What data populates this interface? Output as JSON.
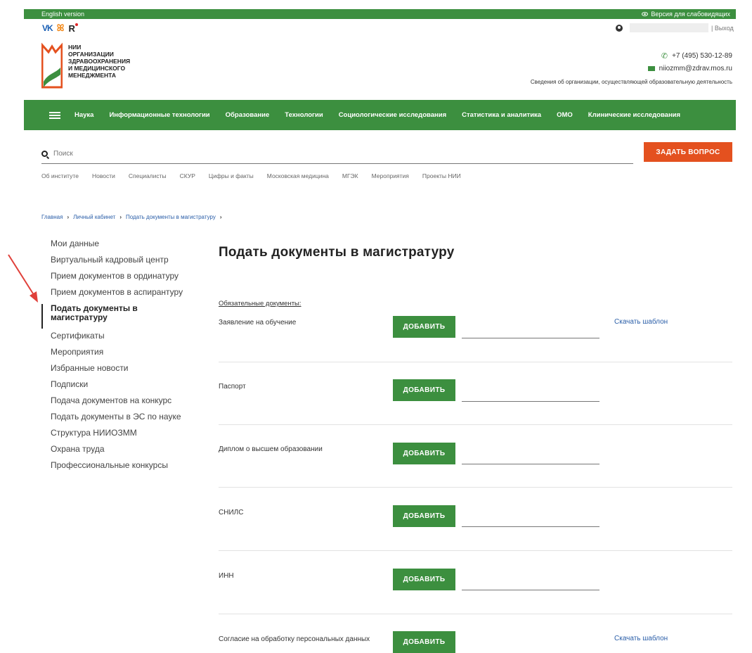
{
  "topbar": {
    "lang": "English version",
    "vision": "Версия для слабовидящих"
  },
  "social": {
    "vk": "vk-icon",
    "ok": "odnoklassniki-icon",
    "rutube": "rutube-icon"
  },
  "user": {
    "logout": "| Выход"
  },
  "logo": {
    "line1": "НИИ",
    "line2": "ОРГАНИЗАЦИИ",
    "line3": "ЗДРАВООХРАНЕНИЯ",
    "line4": "И МЕДИЦИНСКОГО",
    "line5": "МЕНЕДЖМЕНТА"
  },
  "contacts": {
    "phone": "+7 (495) 530-12-89",
    "email": "niiozmm@zdrav.mos.ru",
    "legal": "Сведения об организации, осуществляющей образовательную деятельность"
  },
  "mainnav": [
    "Наука",
    "Информационные технологии",
    "Образование",
    "Технологии",
    "Социологические исследования",
    "Статистика и аналитика",
    "ОМО",
    "Клинические исследования"
  ],
  "search": {
    "placeholder": "Поиск"
  },
  "ask_button": "ЗАДАТЬ ВОПРОС",
  "subnav": [
    "Об институте",
    "Новости",
    "Специалисты",
    "СКУР",
    "Цифры и факты",
    "Московская медицина",
    "МГЭК",
    "Мероприятия",
    "Проекты НИИ"
  ],
  "breadcrumb": [
    "Главная",
    "Личный кабинет",
    "Подать документы в магистратуру"
  ],
  "sidebar": [
    "Мои данные",
    "Виртуальный кадровый центр",
    "Прием документов в ординатуру",
    "Прием документов в аспирантуру",
    "Подать документы в магистратуру",
    "Сертификаты",
    "Мероприятия",
    "Избранные новости",
    "Подписки",
    "Подача документов на конкурс",
    "Подать документы в ЭС по науке",
    "Структура НИИОЗММ",
    "Охрана труда",
    "Профессиональные конкурсы"
  ],
  "page_title": "Подать документы в магистратуру",
  "required_label": "Обязательные документы:",
  "add_label": "ДОБАВИТЬ",
  "template_label": "Скачать шаблон",
  "documents": [
    {
      "label": "Заявление на обучение"
    },
    {
      "label": "Паспорт"
    },
    {
      "label": "Диплом о высшем образовании"
    },
    {
      "label": "СНИЛС"
    },
    {
      "label": "ИНН"
    },
    {
      "label": "Согласие на обработку персональных данных"
    }
  ]
}
